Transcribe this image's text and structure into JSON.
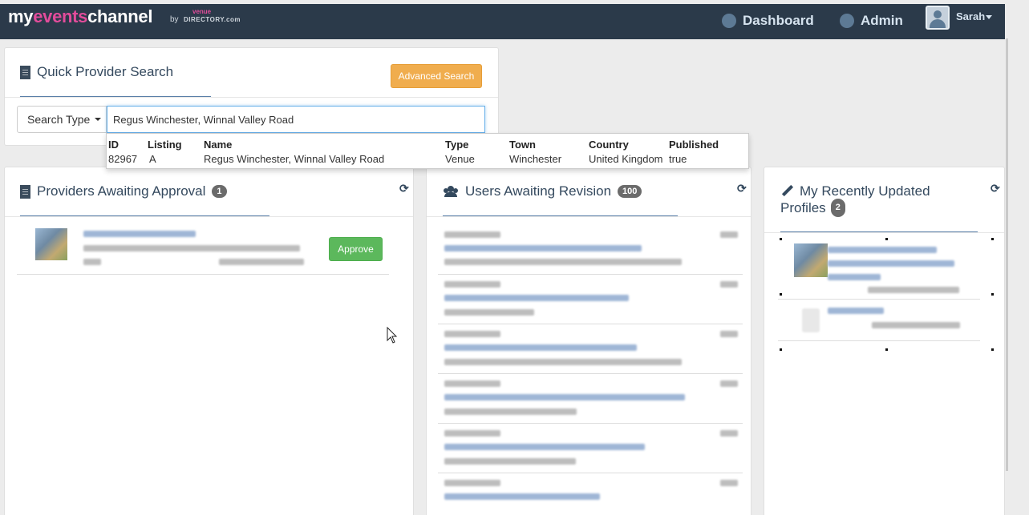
{
  "nav": {
    "logo_my": "my",
    "logo_events": "events",
    "logo_channel": "channel",
    "logo_by": "by",
    "logo_venue": "venue",
    "logo_directory": "DIRECTORY.com",
    "dashboard": "Dashboard",
    "admin": "Admin",
    "user": "Sarah"
  },
  "search": {
    "title": "Quick Provider Search",
    "advanced": "Advanced Search",
    "type_label": "Search Type",
    "value": "Regus Winchester, Winnal Valley Road"
  },
  "results": {
    "headers": [
      "ID",
      "Listing",
      "Name",
      "Type",
      "Town",
      "Country",
      "Published"
    ],
    "row": [
      "82967",
      "A",
      "Regus Winchester, Winnal Valley Road",
      "Venue",
      "Winchester",
      "United Kingdom",
      "true"
    ]
  },
  "providers": {
    "title": "Providers Awaiting Approval",
    "count": "1",
    "approve": "Approve"
  },
  "users": {
    "title": "Users Awaiting Revision",
    "count": "100"
  },
  "recent": {
    "title_line1": "My Recently Updated",
    "title_line2": "Profiles",
    "count": "2"
  },
  "colors": {
    "navbar": "#2b3a4a",
    "accent_pink": "#e24c9b",
    "warning": "#f0ad4e",
    "success": "#5cb85c"
  }
}
